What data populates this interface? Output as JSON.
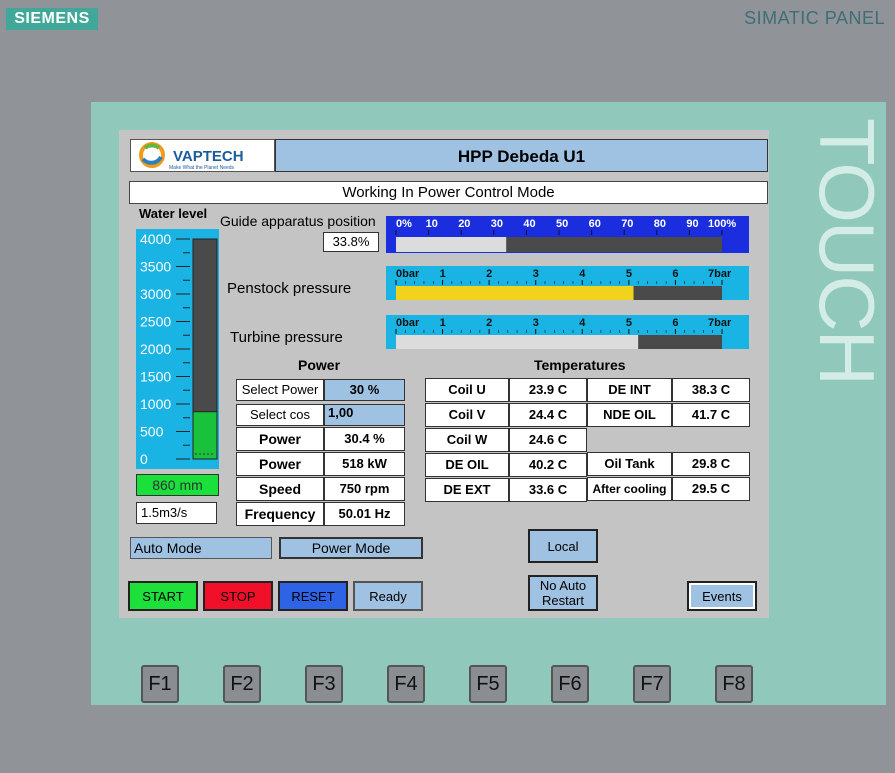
{
  "device": {
    "brand": "SIEMENS",
    "model": "SIMATIC PANEL",
    "touch_label": "TOUCH"
  },
  "header": {
    "logo_text": "VAPTECH",
    "logo_tagline": "Make What the Planet Needs",
    "title": "HPP Debeda U1",
    "mode": "Working In Power Control Mode"
  },
  "water_level": {
    "title": "Water level",
    "scale": [
      "4000",
      "3500",
      "3000",
      "2500",
      "2000",
      "1500",
      "1000",
      "500",
      "0"
    ],
    "value_mm": 860,
    "max": 4000,
    "readout": "860 mm",
    "flow": "1.5m3/s",
    "fill_color": "#19c23a"
  },
  "guide_apparatus": {
    "label": "Guide apparatus position",
    "readout": "33.8%",
    "value_percent": 33.8,
    "ticks": [
      "0%",
      "10",
      "20",
      "30",
      "40",
      "50",
      "60",
      "70",
      "80",
      "90",
      "100%"
    ]
  },
  "penstock": {
    "label": "Penstock pressure",
    "ticks": [
      "0bar",
      "1",
      "2",
      "3",
      "4",
      "5",
      "6",
      "7bar"
    ],
    "value_bar": 5.1,
    "max_bar": 7,
    "fill_color": "#f1d21c"
  },
  "turbine": {
    "label": "Turbine pressure",
    "ticks": [
      "0bar",
      "1",
      "2",
      "3",
      "4",
      "5",
      "6",
      "7bar"
    ],
    "value_bar": 5.2,
    "max_bar": 7,
    "fill_color": "#dcdcdc"
  },
  "power": {
    "title": "Power",
    "rows": [
      {
        "label": "Select Power",
        "value": "30 %"
      },
      {
        "label": "Select cos",
        "value": "1,00"
      },
      {
        "label": "Power",
        "value": "30.4 %"
      },
      {
        "label": "Power",
        "value": "518 kW"
      },
      {
        "label": "Speed",
        "value": "750 rpm"
      },
      {
        "label": "Frequency",
        "value": "50.01 Hz"
      }
    ]
  },
  "temperatures": {
    "title": "Temperatures",
    "left": [
      {
        "label": "Coil U",
        "value": "23.9 C"
      },
      {
        "label": "Coil V",
        "value": "24.4 C"
      },
      {
        "label": "Coil W",
        "value": "24.6 C"
      },
      {
        "label": "DE OIL",
        "value": "40.2 C"
      },
      {
        "label": "DE EXT",
        "value": "33.6 C"
      }
    ],
    "right": [
      {
        "label": "DE INT",
        "value": "38.3 C"
      },
      {
        "label": "NDE OIL",
        "value": "41.7 C"
      },
      {
        "label": "Oil Tank",
        "value": "29.8 C"
      },
      {
        "label": "After cooling",
        "value": "29.5 C"
      }
    ]
  },
  "status": {
    "auto_mode": "Auto Mode",
    "power_mode": "Power Mode"
  },
  "buttons": {
    "start": "START",
    "stop": "STOP",
    "reset": "RESET",
    "ready": "Ready",
    "local": "Local",
    "no_auto_restart_1": "No Auto",
    "no_auto_restart_2": "Restart",
    "events": "Events"
  },
  "fkeys": [
    "F1",
    "F2",
    "F3",
    "F4",
    "F5",
    "F6",
    "F7",
    "F8"
  ],
  "colors": {
    "start": "#1ee03a",
    "stop": "#f0102a",
    "reset": "#2f63e6",
    "header_blue": "#9fc2e3",
    "gauge_cyan": "#19b4e4",
    "gauge_blue": "#1a2ee0"
  }
}
